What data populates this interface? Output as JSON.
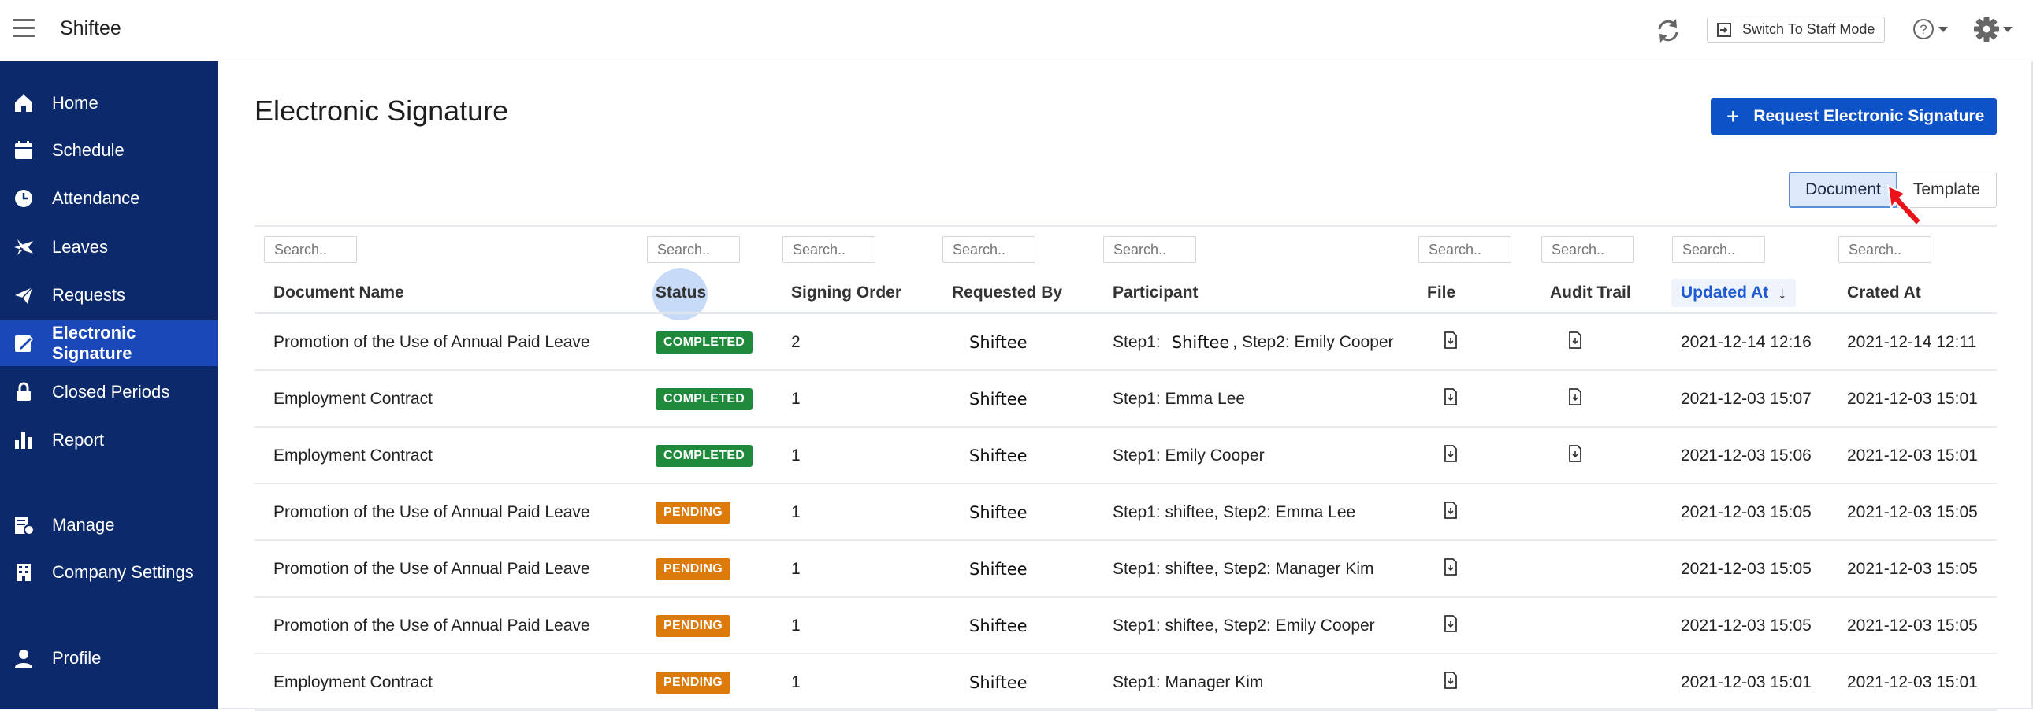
{
  "app": {
    "brand": "Shiftee"
  },
  "header": {
    "staff_mode_label": "Switch To Staff Mode"
  },
  "colors": {
    "sidebar_bg": "#0c2a6b",
    "sidebar_active": "#1a48b8",
    "primary": "#0d52c7",
    "completed": "#1e8a3b",
    "pending": "#dc7a0c",
    "sorted": "#1f5ad0"
  },
  "sidebar": {
    "items": [
      {
        "label": "Home",
        "icon": "home-icon"
      },
      {
        "label": "Schedule",
        "icon": "calendar-icon"
      },
      {
        "label": "Attendance",
        "icon": "clock-icon"
      },
      {
        "label": "Leaves",
        "icon": "airplane-icon"
      },
      {
        "label": "Requests",
        "icon": "paper-plane-icon"
      },
      {
        "label": "Electronic Signature",
        "icon": "signature-icon",
        "active": true
      },
      {
        "label": "Closed Periods",
        "icon": "lock-icon"
      },
      {
        "label": "Report",
        "icon": "bar-chart-icon"
      },
      {
        "label": "Manage",
        "icon": "manage-icon"
      },
      {
        "label": "Company Settings",
        "icon": "building-icon"
      },
      {
        "label": "Profile",
        "icon": "user-icon"
      }
    ]
  },
  "main": {
    "title": "Electronic Signature",
    "request_button": "Request Electronic Signature",
    "segment": {
      "document": "Document",
      "template": "Template",
      "selected": "Document"
    }
  },
  "table": {
    "search_placeholder": "Search..",
    "columns": [
      "Document Name",
      "Status",
      "Signing Order",
      "Requested By",
      "Participant",
      "File",
      "Audit Trail",
      "Updated At",
      "Crated At"
    ],
    "sort_indicator": "↓",
    "rows": [
      {
        "name": "Promotion of the Use of Annual Paid Leave",
        "status": "COMPLETED",
        "order": "2",
        "requested_by": "Shiftee",
        "participant_a": "Step1:",
        "participant_brand": "Shiftee",
        "participant_b": ", Step2: Emily Cooper",
        "audit": true,
        "updated": "2021-12-14 12:16",
        "created": "2021-12-14 12:11"
      },
      {
        "name": "Employment Contract",
        "status": "COMPLETED",
        "order": "1",
        "requested_by": "Shiftee",
        "participant_a": "Step1: Emma Lee",
        "participant_brand": "",
        "participant_b": "",
        "audit": true,
        "updated": "2021-12-03 15:07",
        "created": "2021-12-03 15:01"
      },
      {
        "name": "Employment Contract",
        "status": "COMPLETED",
        "order": "1",
        "requested_by": "Shiftee",
        "participant_a": "Step1: Emily Cooper",
        "participant_brand": "",
        "participant_b": "",
        "audit": true,
        "updated": "2021-12-03 15:06",
        "created": "2021-12-03 15:01"
      },
      {
        "name": "Promotion of the Use of Annual Paid Leave",
        "status": "PENDING",
        "order": "1",
        "requested_by": "Shiftee",
        "participant_a": "Step1: shiftee, Step2: Emma Lee",
        "participant_brand": "",
        "participant_b": "",
        "audit": false,
        "updated": "2021-12-03 15:05",
        "created": "2021-12-03 15:05"
      },
      {
        "name": "Promotion of the Use of Annual Paid Leave",
        "status": "PENDING",
        "order": "1",
        "requested_by": "Shiftee",
        "participant_a": "Step1: shiftee, Step2: Manager Kim",
        "participant_brand": "",
        "participant_b": "",
        "audit": false,
        "updated": "2021-12-03 15:05",
        "created": "2021-12-03 15:05"
      },
      {
        "name": "Promotion of the Use of Annual Paid Leave",
        "status": "PENDING",
        "order": "1",
        "requested_by": "Shiftee",
        "participant_a": "Step1: shiftee, Step2: Emily Cooper",
        "participant_brand": "",
        "participant_b": "",
        "audit": false,
        "updated": "2021-12-03 15:05",
        "created": "2021-12-03 15:05"
      },
      {
        "name": "Employment Contract",
        "status": "PENDING",
        "order": "1",
        "requested_by": "Shiftee",
        "participant_a": "Step1: Manager Kim",
        "participant_brand": "",
        "participant_b": "",
        "audit": false,
        "updated": "2021-12-03 15:01",
        "created": "2021-12-03 15:01"
      }
    ]
  }
}
